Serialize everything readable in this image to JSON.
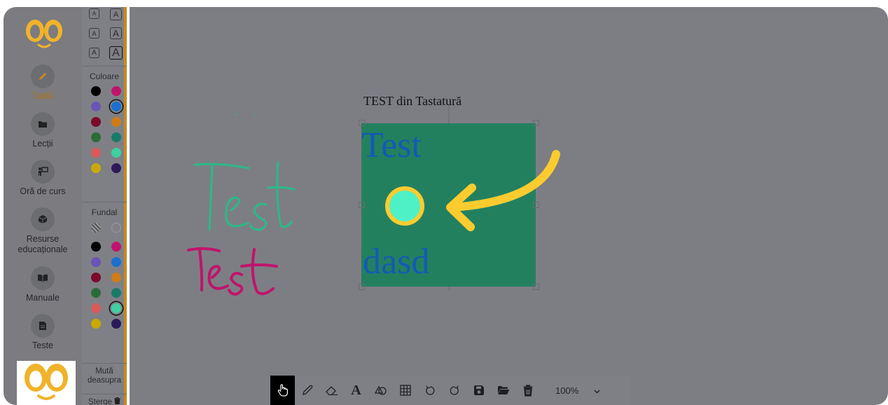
{
  "sidebar": {
    "items": [
      {
        "label": "Tablă",
        "icon": "pencil-icon"
      },
      {
        "label": "Lecții",
        "icon": "folder-icon"
      },
      {
        "label": "Oră de curs",
        "icon": "teacher-board-icon"
      },
      {
        "label": "Resurse educaționale",
        "icon": "cube-icon"
      },
      {
        "label": "Manuale",
        "icon": "book-icon"
      },
      {
        "label": "Teste",
        "icon": "document-icon"
      }
    ]
  },
  "palette": {
    "color_title": "Culoare",
    "background_title": "Fundal",
    "size_glyph": "A",
    "move_above_label": "Mută deasupra",
    "delete_label": "Șterge",
    "colors": [
      "#000000",
      "#c0146c",
      "#6a55b5",
      "#1a6fd0",
      "#7a0a2a",
      "#cf7c14",
      "#2b6b3a",
      "#1a7a6a",
      "#d95a5a",
      "#3fcfa0",
      "#c9a800",
      "#2a1a5a"
    ],
    "selected_color_index": 3,
    "selected_background_index": 9,
    "accent": "#c8891e"
  },
  "canvas": {
    "keyboard_text": "TEST din Tastatură",
    "box_text_top": "Test",
    "box_text_bottom": "dasd",
    "box_color": "#23805f",
    "box_text_color": "#1559b5",
    "handwriting_green": "Test",
    "handwriting_magenta": "Test",
    "pointer_color": "#fccc2f",
    "pointer_fill": "#4ef1c6"
  },
  "toolbar": {
    "tools": [
      "hand-pointer-icon",
      "pen-icon",
      "eraser-icon",
      "text-icon",
      "shapes-icon",
      "grid-icon",
      "undo-icon",
      "redo-icon",
      "save-icon",
      "open-folder-icon",
      "trash-icon"
    ],
    "text_tool_glyph": "A",
    "zoom_value": "100%"
  }
}
